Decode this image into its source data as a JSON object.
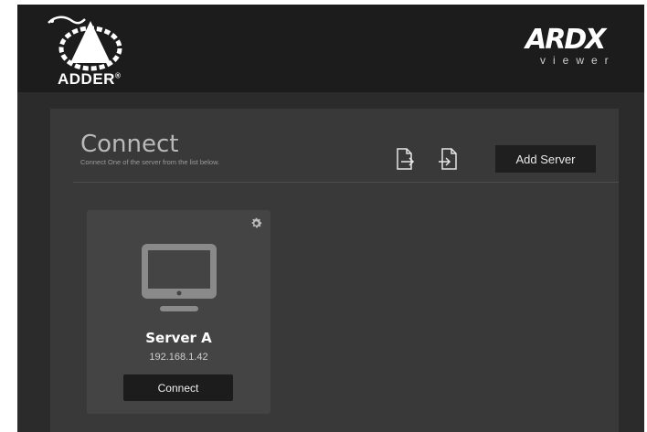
{
  "header": {
    "brand_left": "ADDER",
    "brand_left_mark": "®",
    "brand_right": "ARDX",
    "brand_right_sub": "viewer"
  },
  "connect": {
    "title": "Connect",
    "subtitle": "Connect One of the server from the list below.",
    "export_icon": "file-export-icon",
    "import_icon": "file-import-icon",
    "add_server_label": "Add Server"
  },
  "servers": [
    {
      "name": "Server A",
      "ip": "192.168.1.42",
      "connect_label": "Connect",
      "icon": "monitor-icon",
      "settings_icon": "gear-icon"
    }
  ],
  "colors": {
    "header_bg": "#1c1c1c",
    "panel_bg": "#393939",
    "card_bg": "#444444",
    "button_bg": "#1c1c1c"
  }
}
